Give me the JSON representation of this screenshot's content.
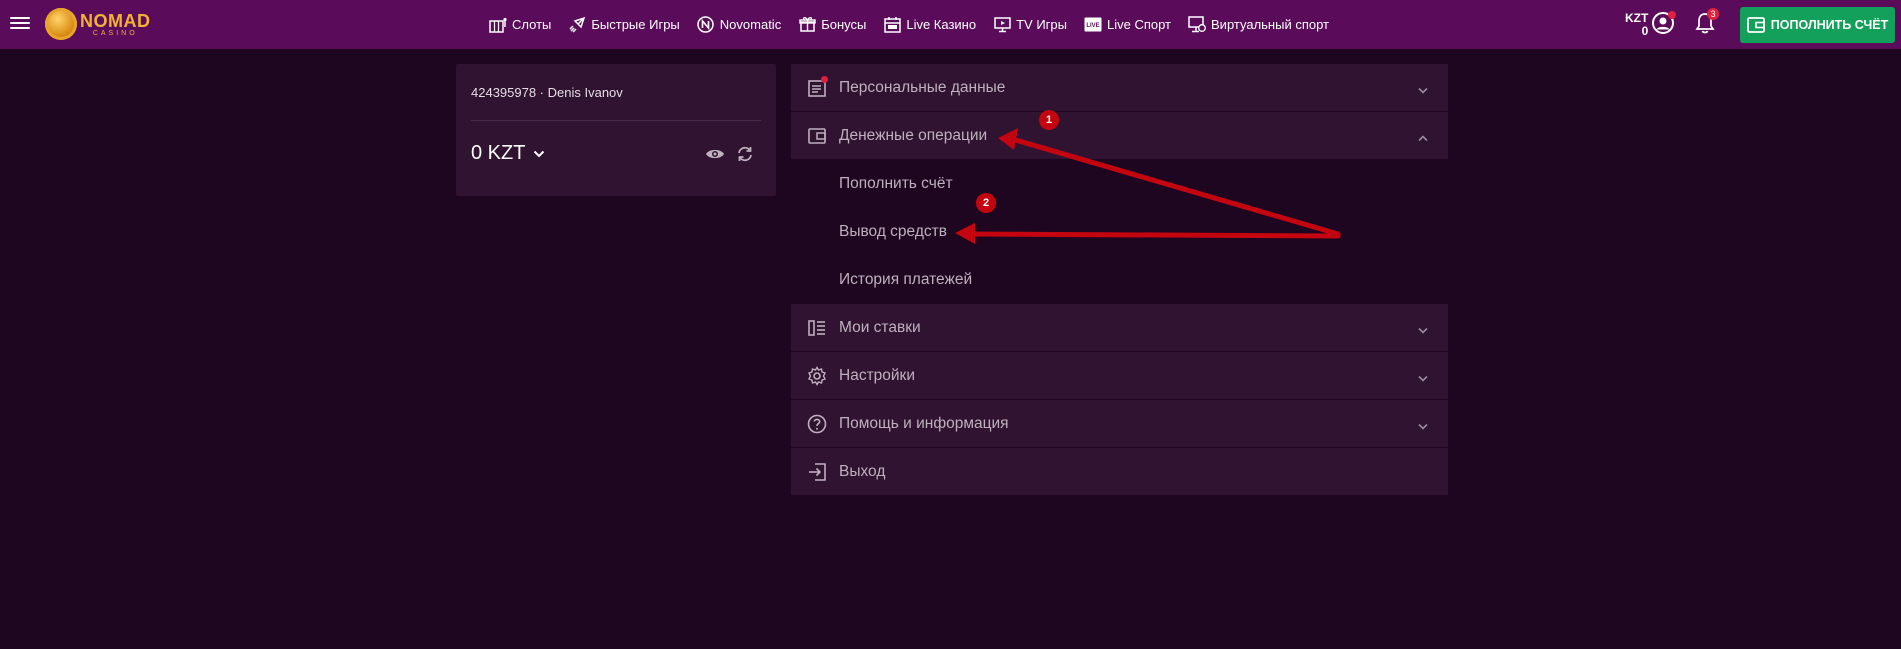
{
  "header": {
    "logo": {
      "name": "NOMAD",
      "sub": "CASINO"
    },
    "nav": [
      {
        "label": "Слоты",
        "icon": "slots-icon"
      },
      {
        "label": "Быстрые Игры",
        "icon": "rocket-icon"
      },
      {
        "label": "Novomatic",
        "icon": "novomatic-icon"
      },
      {
        "label": "Бонусы",
        "icon": "gift-icon"
      },
      {
        "label": "Live Казино",
        "icon": "live-casino-icon"
      },
      {
        "label": "TV Игры",
        "icon": "tv-icon"
      },
      {
        "label": "Live Спорт",
        "icon": "live-sport-icon"
      },
      {
        "label": "Виртуальный спорт",
        "icon": "virtual-sport-icon"
      }
    ],
    "balance": {
      "currency": "KZT",
      "amount": "0"
    },
    "notifications_count": "3",
    "deposit_label": "ПОПОЛНИТЬ СЧЁТ"
  },
  "account": {
    "id_line": "424395978 · Denis Ivanov",
    "balance": "0 KZT"
  },
  "menu": {
    "personal": "Персональные данные",
    "money": "Денежные операции",
    "money_sub": {
      "deposit": "Пополнить счёт",
      "withdraw": "Вывод средств",
      "history": "История платежей"
    },
    "bets": "Мои ставки",
    "settings": "Настройки",
    "help": "Помощь и информация",
    "logout": "Выход"
  },
  "annotations": {
    "marker1": "1",
    "marker2": "2"
  },
  "colors": {
    "header_bg": "#5a0c5a",
    "page_bg": "#1e0520",
    "panel_bg": "#2f1330",
    "deposit_button": "#12a05a",
    "brand_gold": "#f2b233",
    "annotation_red": "#c4050f"
  }
}
